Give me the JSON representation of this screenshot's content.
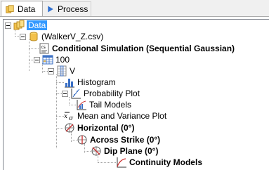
{
  "tabs": [
    {
      "label": "Data",
      "icon": "database-icon",
      "active": true
    },
    {
      "label": "Process",
      "icon": "play-icon",
      "active": false
    }
  ],
  "tree": {
    "root": {
      "label": "Data",
      "selected": true
    },
    "nodes": [
      {
        "label": "(WalkerV_Z.csv)"
      },
      {
        "label": "Conditional Simulation (Sequential Gaussian)"
      },
      {
        "label": "100"
      },
      {
        "label": "V"
      },
      {
        "label": "Histogram"
      },
      {
        "label": "Probability Plot"
      },
      {
        "label": "Tail Models"
      },
      {
        "label": "Mean and Variance Plot"
      },
      {
        "label": "Horizontal (0°)"
      },
      {
        "label": "Across Strike (0°)"
      },
      {
        "label": "Dip Plane (0°)"
      },
      {
        "label": "Continuity Models"
      }
    ]
  },
  "colors": {
    "selection": "#3399ff",
    "folder": "#e8b84a",
    "blue_icon": "#3a6fc4"
  }
}
